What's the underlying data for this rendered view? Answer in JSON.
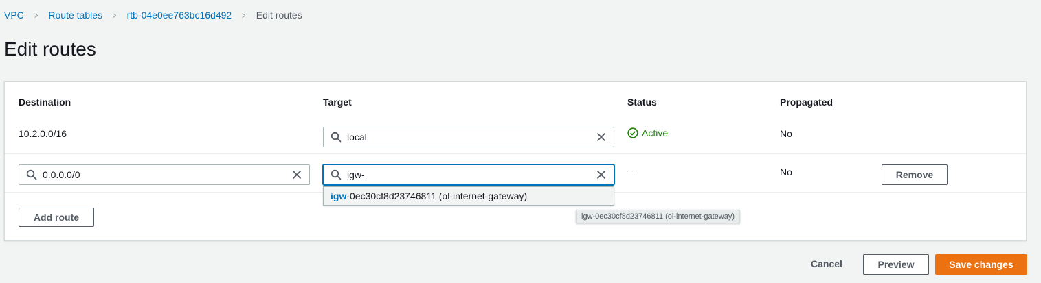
{
  "breadcrumb": {
    "items": [
      {
        "label": "VPC"
      },
      {
        "label": "Route tables"
      },
      {
        "label": "rtb-04e0ee763bc16d492"
      },
      {
        "label": "Edit routes"
      }
    ]
  },
  "page_title": "Edit routes",
  "table": {
    "headers": {
      "destination": "Destination",
      "target": "Target",
      "status": "Status",
      "propagated": "Propagated"
    },
    "rows": [
      {
        "destination": "10.2.0.0/16",
        "target": "local",
        "status": "Active",
        "propagated": "No"
      },
      {
        "destination": "0.0.0.0/0",
        "target": "igw-",
        "status": "–",
        "propagated": "No",
        "remove_label": "Remove"
      }
    ]
  },
  "dropdown": {
    "match": "igw",
    "rest": "-0ec30cf8d23746811 (ol-internet-gateway)"
  },
  "tooltip": "igw-0ec30cf8d23746811 (ol-internet-gateway)",
  "add_route_label": "Add route",
  "footer": {
    "cancel_label": "Cancel",
    "preview_label": "Preview",
    "save_label": "Save changes"
  },
  "colors": {
    "link": "#0073bb",
    "active_status": "#1d8102",
    "primary": "#ec7211",
    "focus": "#0073bb"
  },
  "icons": {
    "search": "search-icon",
    "clear": "close-icon",
    "status": "check-circle-icon",
    "separator": "chevron-right-icon"
  }
}
